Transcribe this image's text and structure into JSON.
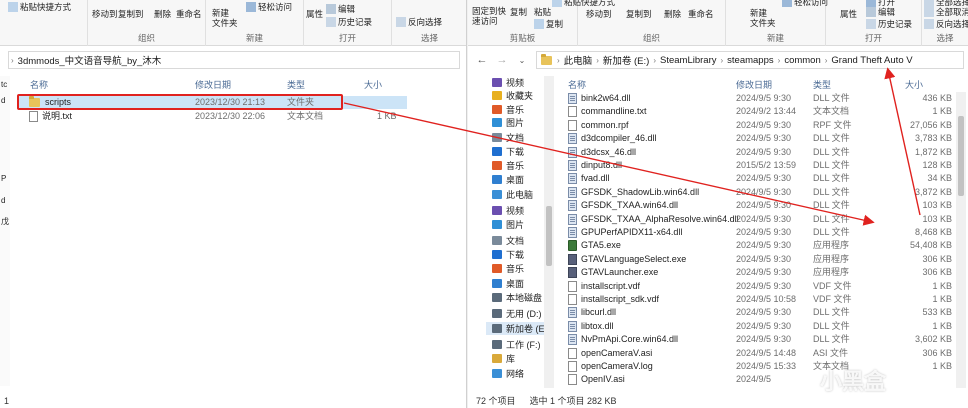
{
  "left": {
    "ribbon": {
      "clipboard_top": "粘贴快捷方式",
      "move_to": "移动到",
      "copy_to": "复制到",
      "delete": "删除",
      "rename": "重命名",
      "new_folder": "新建\n文件夹",
      "easy_access": "轻松访问",
      "properties": "属性",
      "edit": "编辑",
      "history": "历史记录",
      "invert": "反向选择",
      "groups": [
        "组织",
        "新建",
        "打开",
        "选择"
      ]
    },
    "breadcrumb": [
      "3dmmods_中文语音导航_by_沐木"
    ],
    "columns": {
      "name": "名称",
      "date": "修改日期",
      "type": "类型",
      "size": "大小"
    },
    "files": [
      {
        "name": "scripts",
        "date": "2023/12/30 21:13",
        "type": "文件夹",
        "size": "",
        "icon": "folder-icon"
      },
      {
        "name": "说明.txt",
        "date": "2023/12/30 22:06",
        "type": "文本文档",
        "size": "1 KB",
        "icon": "text-file-icon"
      }
    ],
    "side_fragments": [
      "tc",
      "d",
      "P",
      "d",
      "戊"
    ]
  },
  "right": {
    "ribbon": {
      "pin": "固定到快\n速访问",
      "copy": "复制",
      "paste": "粘贴",
      "paste_shortcut": "粘贴快捷方式",
      "move_to": "移动到",
      "copy_to": "复制到",
      "delete": "删除",
      "rename": "重命名",
      "new_folder": "新建\n文件夹",
      "easy_access": "轻松访问",
      "properties": "属性",
      "open": "打开",
      "edit": "编辑",
      "history": "历史记录",
      "select_all": "全部选择",
      "select_none": "全部取消",
      "invert": "反向选择",
      "groups": [
        "剪贴板",
        "组织",
        "新建",
        "打开",
        "选择"
      ]
    },
    "breadcrumb": [
      "此电脑",
      "新加卷 (E:)",
      "SteamLibrary",
      "steamapps",
      "common",
      "Grand Theft Auto V"
    ],
    "columns": {
      "name": "名称",
      "date": "修改日期",
      "type": "类型",
      "size": "大小"
    },
    "nav": [
      {
        "label": "视频",
        "icon": "video-icon",
        "color": "#6b4fb0"
      },
      {
        "label": "收藏夹",
        "icon": "star-icon",
        "color": "#e8b020"
      },
      {
        "label": "音乐",
        "icon": "music-icon",
        "color": "#e05a28"
      },
      {
        "label": "图片",
        "icon": "picture-icon",
        "color": "#2f8fd6"
      },
      {
        "label": "文档",
        "icon": "document-icon",
        "color": "#7a8a9a"
      },
      {
        "label": "下载",
        "icon": "download-icon",
        "color": "#1f6fd0"
      },
      {
        "label": "音乐",
        "icon": "music-icon",
        "color": "#e05a28"
      },
      {
        "label": "桌面",
        "icon": "desktop-icon",
        "color": "#2f7fd0"
      },
      {
        "label": "此电脑",
        "icon": "computer-icon",
        "color": "#3a8fd6"
      },
      {
        "label": "视频",
        "icon": "video-icon",
        "color": "#6b4fb0"
      },
      {
        "label": "图片",
        "icon": "picture-icon",
        "color": "#2f8fd6"
      },
      {
        "label": "文档",
        "icon": "document-icon",
        "color": "#7a8a9a"
      },
      {
        "label": "下载",
        "icon": "download-icon",
        "color": "#1f6fd0"
      },
      {
        "label": "音乐",
        "icon": "music-icon",
        "color": "#e05a28"
      },
      {
        "label": "桌面",
        "icon": "desktop-icon",
        "color": "#2f7fd0"
      },
      {
        "label": "本地磁盘 (C",
        "icon": "drive-icon",
        "color": "#5a6a7a"
      },
      {
        "label": "无用 (D:)",
        "icon": "drive-icon",
        "color": "#5a6a7a"
      },
      {
        "label": "新加卷 (E:)",
        "icon": "drive-icon",
        "color": "#5a6a7a"
      },
      {
        "label": "工作 (F:)",
        "icon": "drive-icon",
        "color": "#5a6a7a"
      },
      {
        "label": "库",
        "icon": "library-icon",
        "color": "#d9a93a"
      },
      {
        "label": "网络",
        "icon": "network-icon",
        "color": "#3a8fd6"
      }
    ],
    "files": [
      {
        "name": "bink2w64.dll",
        "date": "2024/9/5 9:30",
        "type": "DLL 文件",
        "size": "436 KB",
        "icon": "dll-file-icon"
      },
      {
        "name": "commandline.txt",
        "date": "2024/9/2 13:44",
        "type": "文本文档",
        "size": "1 KB",
        "icon": "text-file-icon"
      },
      {
        "name": "common.rpf",
        "date": "2024/9/5 9:30",
        "type": "RPF 文件",
        "size": "27,056 KB",
        "icon": "file-icon"
      },
      {
        "name": "d3dcompiler_46.dll",
        "date": "2024/9/5 9:30",
        "type": "DLL 文件",
        "size": "3,783 KB",
        "icon": "dll-file-icon"
      },
      {
        "name": "d3dcsx_46.dll",
        "date": "2024/9/5 9:30",
        "type": "DLL 文件",
        "size": "1,872 KB",
        "icon": "dll-file-icon"
      },
      {
        "name": "dinput8.dll",
        "date": "2015/5/2 13:59",
        "type": "DLL 文件",
        "size": "128 KB",
        "icon": "dll-file-icon"
      },
      {
        "name": "fvad.dll",
        "date": "2024/9/5 9:30",
        "type": "DLL 文件",
        "size": "34 KB",
        "icon": "dll-file-icon"
      },
      {
        "name": "GFSDK_ShadowLib.win64.dll",
        "date": "2024/9/5 9:30",
        "type": "DLL 文件",
        "size": "3,872 KB",
        "icon": "dll-file-icon"
      },
      {
        "name": "GFSDK_TXAA.win64.dll",
        "date": "2024/9/5 9:30",
        "type": "DLL 文件",
        "size": "103 KB",
        "icon": "dll-file-icon"
      },
      {
        "name": "GFSDK_TXAA_AlphaResolve.win64.dll",
        "date": "2024/9/5 9:30",
        "type": "DLL 文件",
        "size": "103 KB",
        "icon": "dll-file-icon"
      },
      {
        "name": "GPUPerfAPIDX11-x64.dll",
        "date": "2024/9/5 9:30",
        "type": "DLL 文件",
        "size": "8,468 KB",
        "icon": "dll-file-icon"
      },
      {
        "name": "GTA5.exe",
        "date": "2024/9/5 9:30",
        "type": "应用程序",
        "size": "54,408 KB",
        "icon": "gta5-app-icon"
      },
      {
        "name": "GTAVLanguageSelect.exe",
        "date": "2024/9/5 9:30",
        "type": "应用程序",
        "size": "306 KB",
        "icon": "exe-file-icon"
      },
      {
        "name": "GTAVLauncher.exe",
        "date": "2024/9/5 9:30",
        "type": "应用程序",
        "size": "306 KB",
        "icon": "exe-file-icon"
      },
      {
        "name": "installscript.vdf",
        "date": "2024/9/5 9:30",
        "type": "VDF 文件",
        "size": "1 KB",
        "icon": "file-icon"
      },
      {
        "name": "installscript_sdk.vdf",
        "date": "2024/9/5 10:58",
        "type": "VDF 文件",
        "size": "1 KB",
        "icon": "file-icon"
      },
      {
        "name": "libcurl.dll",
        "date": "2024/9/5 9:30",
        "type": "DLL 文件",
        "size": "533 KB",
        "icon": "dll-file-icon"
      },
      {
        "name": "libtox.dll",
        "date": "2024/9/5 9:30",
        "type": "DLL 文件",
        "size": "1 KB",
        "icon": "dll-file-icon"
      },
      {
        "name": "NvPmApi.Core.win64.dll",
        "date": "2024/9/5 9:30",
        "type": "DLL 文件",
        "size": "3,602 KB",
        "icon": "dll-file-icon"
      },
      {
        "name": "openCameraV.asi",
        "date": "2024/9/5 14:48",
        "type": "ASI 文件",
        "size": "306 KB",
        "icon": "file-icon"
      },
      {
        "name": "openCameraV.log",
        "date": "2024/9/5 15:33",
        "type": "文本文档",
        "size": "1 KB",
        "icon": "text-file-icon"
      },
      {
        "name": "OpenIV.asi",
        "date": "2024/9/5",
        "type": "",
        "size": "",
        "icon": "file-icon"
      }
    ],
    "status": {
      "count": "72 个项目",
      "selected": "选中 1 个项目  282 KB"
    }
  },
  "watermark": "小黑盒",
  "colors": {
    "highlight": "#e0221f",
    "folder": "#e8c35a",
    "column_header": "#4a6a94"
  }
}
